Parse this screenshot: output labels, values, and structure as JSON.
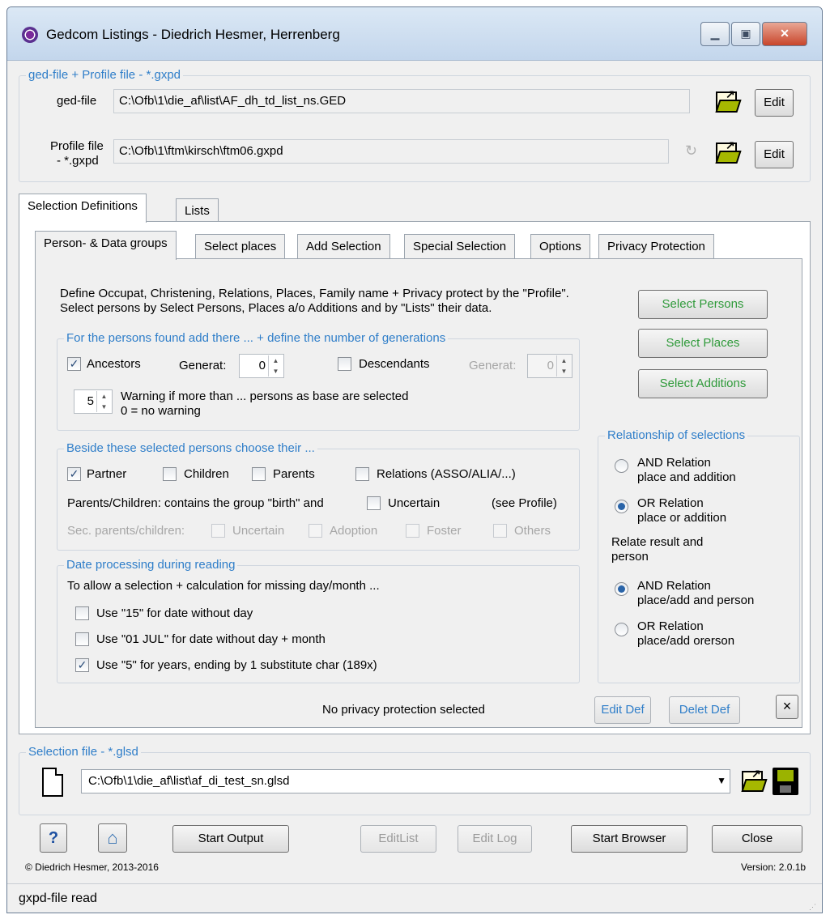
{
  "window": {
    "title": "Gedcom Listings  -  Diedrich Hesmer, Herrenberg",
    "min_glyph": "▁",
    "max_glyph": "▣",
    "close_glyph": "✕"
  },
  "files": {
    "legend": "ged-file + Profile file - *.gxpd",
    "ged_label": "ged-file",
    "ged_value": "C:\\Ofb\\1\\die_af\\list\\AF_dh_td_list_ns.GED",
    "profile_label_1": "Profile file",
    "profile_label_2": "- *.gxpd",
    "profile_value": "C:\\Ofb\\1\\ftm\\kirsch\\ftm06.gxpd",
    "edit": "Edit",
    "refresh_glyph": "↻"
  },
  "outer_tabs": [
    "Selection Definitions",
    "Lists"
  ],
  "inner_tabs": [
    "Person- & Data groups",
    "Select places",
    "Add Selection",
    "Special Selection",
    "Options",
    "Privacy Protection"
  ],
  "intro": {
    "line1": "Define Occupat, Christening, Relations, Places, Family name + Privacy protect by the \"Profile\".",
    "line2": "Select persons by Select Persons, Places a/o Additions and by \"Lists\" their data."
  },
  "select_buttons": [
    "Select Persons",
    "Select Places",
    "Select Additions"
  ],
  "generations": {
    "legend": "For the persons found add there ... + define the number of generations",
    "ancestors": "Ancestors",
    "ancestors_checked": true,
    "generat": "Generat:",
    "anc_value": "0",
    "descendants": "Descendants",
    "descendants_checked": false,
    "desc_value": "0",
    "warn_value": "5",
    "warn_line1": "Warning if more than ... persons as base are selected",
    "warn_line2": "0 = no warning"
  },
  "beside": {
    "legend": "Beside these selected persons choose their ...",
    "partner": "Partner",
    "children": "Children",
    "parents": "Parents",
    "relations": "Relations (ASSO/ALIA/...)",
    "pc_text": "Parents/Children: contains the group \"birth\" and",
    "uncertain": "Uncertain",
    "see_profile": "(see Profile)",
    "sec_label": "Sec. parents/children:",
    "sec_uncertain": "Uncertain",
    "adoption": "Adoption",
    "foster": "Foster",
    "others": "Others"
  },
  "date": {
    "legend": "Date processing during reading",
    "intro": "To allow a selection + calculation for missing day/month ...",
    "opt1": "Use \"15\" for date without day",
    "opt2": "Use \"01 JUL\" for date without day + month",
    "opt3": "Use \"5\" for years, ending by 1 substitute char (189x)"
  },
  "relationship": {
    "legend": "Relationship of selections",
    "and1_a": "AND Relation",
    "and1_b": "place and addition",
    "or1_a": "OR Relation",
    "or1_b": "place or addition",
    "relate_a": "Relate result and",
    "relate_b": "person",
    "and2_a": "AND Relation",
    "and2_b": "place/add and person",
    "or2_a": "OR Relation",
    "or2_b": "place/add orerson"
  },
  "privacy_status": "No privacy protection selected",
  "edit_def": "Edit Def",
  "delet_def": "Delet Def",
  "clear_glyph": "×",
  "selection_file": {
    "legend": "Selection file - *.glsd",
    "value": "C:\\Ofb\\1\\die_af\\list\\af_di_test_sn.glsd"
  },
  "bottom": {
    "help": "?",
    "home_glyph": "⌂",
    "start_output": "Start Output",
    "edit_list": "EditList",
    "edit_log": "Edit Log",
    "start_browser": "Start Browser",
    "close": "Close",
    "copyright": "© Diedrich Hesmer,  2013-2016",
    "version": "Version: 2.0.1b"
  },
  "status": "gxpd-file read"
}
